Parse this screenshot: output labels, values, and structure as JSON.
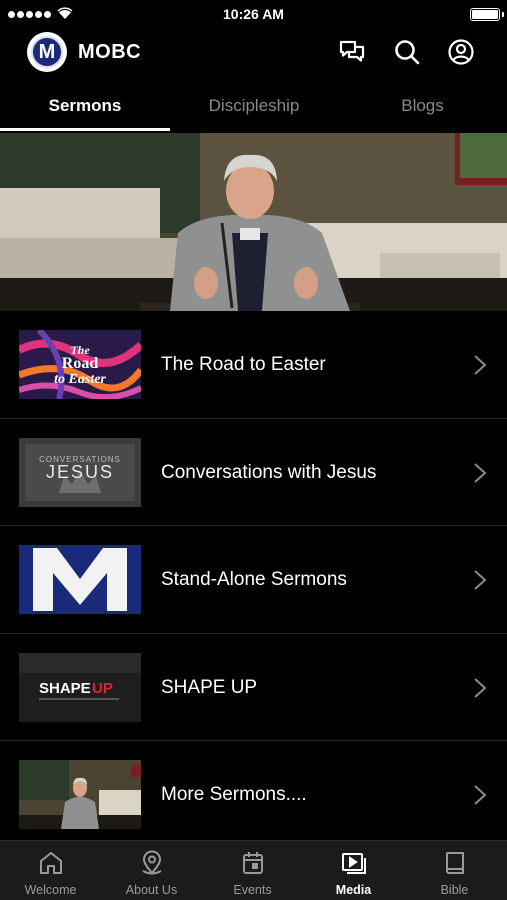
{
  "status_bar": {
    "time": "10:26 AM"
  },
  "header": {
    "logo_letter": "M",
    "app_title": "MOBC"
  },
  "tabs": [
    {
      "label": "Sermons",
      "active": true
    },
    {
      "label": "Discipleship",
      "active": false
    },
    {
      "label": "Blogs",
      "active": false
    }
  ],
  "series": [
    {
      "title": "The Road to Easter",
      "thumb_text": "The Road to Easter"
    },
    {
      "title": "Conversations with Jesus",
      "thumb_text_small": "CONVERSATIONS",
      "thumb_text_big": "JESUS"
    },
    {
      "title": "Stand-Alone Sermons",
      "thumb_text": "M"
    },
    {
      "title": "SHAPE UP",
      "thumb_text_a": "SHAPE",
      "thumb_text_b": "UP"
    },
    {
      "title": "More Sermons...."
    }
  ],
  "bottom_nav": [
    {
      "label": "Welcome",
      "icon": "home-icon",
      "active": false
    },
    {
      "label": "About Us",
      "icon": "location-pin-icon",
      "active": false
    },
    {
      "label": "Events",
      "icon": "calendar-icon",
      "active": false
    },
    {
      "label": "Media",
      "icon": "media-play-icon",
      "active": true
    },
    {
      "label": "Bible",
      "icon": "book-icon",
      "active": false
    }
  ],
  "colors": {
    "background": "#000000",
    "accent_red": "#e0212e",
    "logo_blue": "#1c2a7a",
    "nav_bg": "#1b1b1b"
  }
}
